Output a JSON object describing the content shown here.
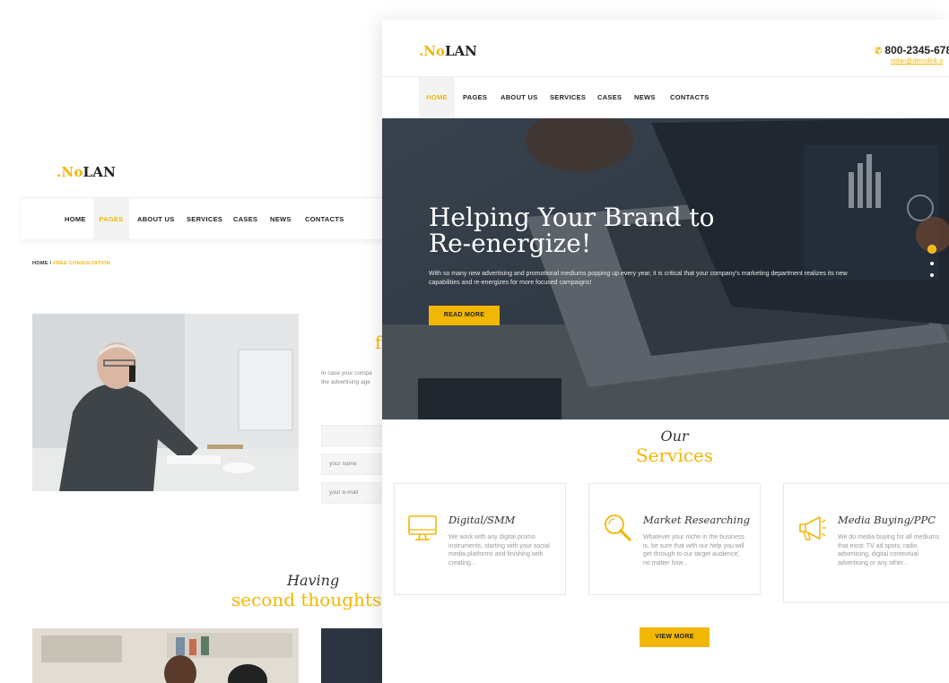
{
  "back_page": {
    "logo": {
      "prefix": ".No",
      "suffix": "LAN"
    },
    "nav": [
      "HOME",
      "PAGES",
      "ABOUT US",
      "SERVICES",
      "CASES",
      "NEWS",
      "CONTACTS"
    ],
    "active_nav": "PAGES",
    "breadcrumb": {
      "home": "HOME",
      "separator": "/",
      "current": "FREE CONSULTATION"
    },
    "partial_heading": "f",
    "intro_partial": [
      "In case your compa",
      "the advertising age"
    ],
    "form": {
      "name_placeholder": "your name",
      "email_placeholder": "your e-mail"
    },
    "section_title_top": "Having",
    "section_title_bottom": "second thoughts"
  },
  "front_page": {
    "logo": {
      "prefix": ".No",
      "suffix": "LAN"
    },
    "phone": "800-2345-678",
    "email": "nolan@demolink.o",
    "nav": [
      "HOME",
      "PAGES",
      "ABOUT US",
      "SERVICES",
      "CASES",
      "NEWS",
      "CONTACTS"
    ],
    "active_nav": "HOME",
    "hero": {
      "title_line1": "Helping Your Brand to",
      "title_line2": "Re-energize!",
      "subtitle": "With so many new advertising and promotional mediums popping up every year, it is critical that your company's marketing department realizes its new capabilities and re-energizes for more focused campaigns!",
      "button": "READ MORE",
      "slides_count": 3,
      "active_slide": 1
    },
    "services_heading": {
      "top": "Our",
      "bottom": "Services"
    },
    "services": [
      {
        "icon": "monitor-icon",
        "title": "Digital/SMM",
        "text": "We work with any digital promo instruments, starting with your social media platforms and finishing with creating..."
      },
      {
        "icon": "magnifier-icon",
        "title": "Market Researching",
        "text": "Whatever your niche in the business is, be sure that with our help you will get through to our target audience, no matter how..."
      },
      {
        "icon": "megaphone-icon",
        "title": "Media Buying/PPC",
        "text": "We do media buying for all mediums that exist: TV ad spots; radio advertising, digital contextual advertising or any other..."
      }
    ],
    "view_more": "VIEW MORE"
  },
  "colors": {
    "accent": "#f2b705",
    "text": "#333333",
    "muted": "#999999"
  }
}
